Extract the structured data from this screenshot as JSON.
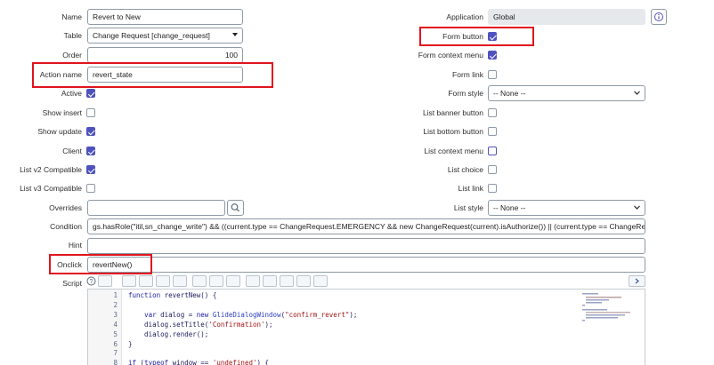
{
  "left_fields": {
    "name": {
      "label": "Name",
      "value": "Revert to New"
    },
    "table": {
      "label": "Table",
      "value": "Change Request [change_request]"
    },
    "order": {
      "label": "Order",
      "value": "100"
    },
    "action_name": {
      "label": "Action name",
      "value": "revert_state"
    },
    "active": {
      "label": "Active",
      "checked": true
    },
    "show_insert": {
      "label": "Show insert",
      "checked": false
    },
    "show_update": {
      "label": "Show update",
      "checked": true
    },
    "client": {
      "label": "Client",
      "checked": true
    },
    "list_v2": {
      "label": "List v2 Compatible",
      "checked": true
    },
    "list_v3": {
      "label": "List v3 Compatible",
      "checked": false
    },
    "overrides": {
      "label": "Overrides",
      "value": ""
    },
    "condition": {
      "label": "Condition",
      "value": "gs.hasRole(\"itil,sn_change_write\") && ((current.type == ChangeRequest.EMERGENCY && new ChangeRequest(current).isAuthorize()) || (current.type == ChangeRequest.NORMAL &"
    },
    "hint": {
      "label": "Hint",
      "value": ""
    },
    "onclick": {
      "label": "Onclick",
      "value": "revertNew()"
    },
    "script": {
      "label": "Script"
    }
  },
  "right_fields": {
    "application": {
      "label": "Application",
      "value": "Global"
    },
    "form_button": {
      "label": "Form button",
      "checked": true
    },
    "form_context_menu": {
      "label": "Form context menu",
      "checked": true
    },
    "form_link": {
      "label": "Form link",
      "checked": false
    },
    "form_style": {
      "label": "Form style",
      "value": "-- None --"
    },
    "list_banner_button": {
      "label": "List banner button",
      "checked": false
    },
    "list_bottom_button": {
      "label": "List bottom button",
      "checked": false
    },
    "list_context_menu": {
      "label": "List context menu",
      "checked": false
    },
    "list_choice": {
      "label": "List choice",
      "checked": false
    },
    "list_link": {
      "label": "List link",
      "checked": false
    },
    "list_style": {
      "label": "List style",
      "value": "-- None --"
    }
  },
  "script_lines": [
    {
      "num": "1",
      "text": "function revertNew() {"
    },
    {
      "num": "2",
      "text": ""
    },
    {
      "num": "3",
      "text": "    var dialog = new GlideDialogWindow(\"confirm_revert\");"
    },
    {
      "num": "4",
      "text": "    dialog.setTitle('Confirmation');"
    },
    {
      "num": "5",
      "text": "    dialog.render();"
    },
    {
      "num": "6",
      "text": "}"
    },
    {
      "num": "7",
      "text": ""
    },
    {
      "num": "8",
      "text": "if (typeof window == 'undefined') {"
    }
  ],
  "icons": {
    "info": "info-icon",
    "search": "search-icon",
    "help": "help-icon",
    "accent": "#4f52bd",
    "highlight": "#e0141e"
  }
}
